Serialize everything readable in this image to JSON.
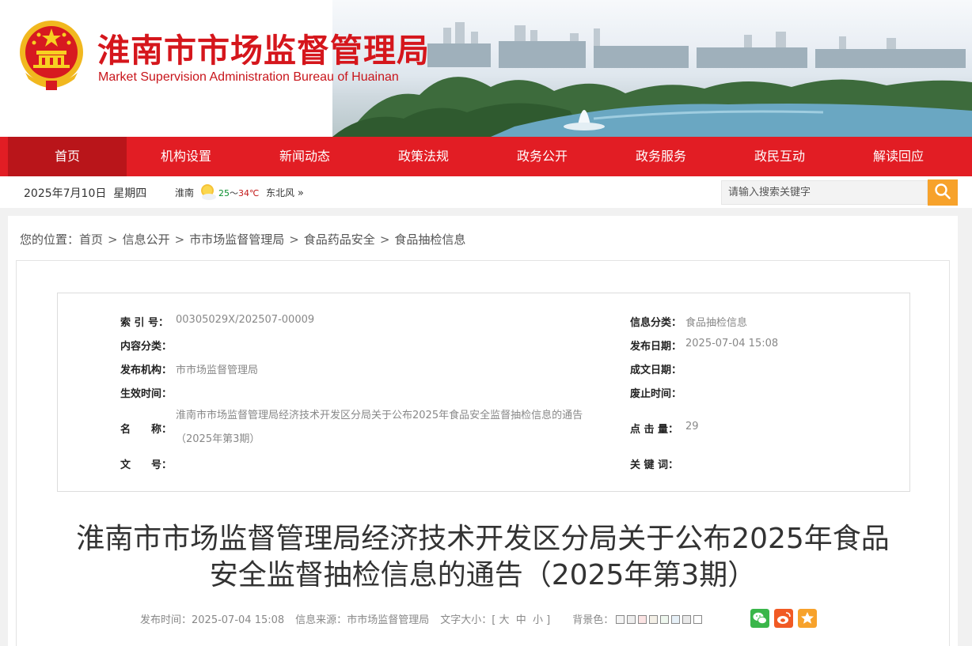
{
  "header": {
    "title": "淮南市市场监督管理局",
    "subtitle": "Market Supervision Administration Bureau of Huainan"
  },
  "nav": {
    "items": [
      {
        "label": "首页"
      },
      {
        "label": "机构设置"
      },
      {
        "label": "新闻动态"
      },
      {
        "label": "政策法规"
      },
      {
        "label": "政务公开"
      },
      {
        "label": "政务服务"
      },
      {
        "label": "政民互动"
      },
      {
        "label": "解读回应"
      }
    ],
    "active_index": 0
  },
  "utility": {
    "date": "2025年7月10日",
    "weekday": "星期四",
    "city": "淮南",
    "temp_low": "25",
    "temp_sep": "～",
    "temp_high": "34℃",
    "wind": "东北风",
    "wind_more": "»",
    "weather_icon": "sun-cloud-icon"
  },
  "search": {
    "placeholder": "请输入搜索关键字",
    "icon": "search-icon"
  },
  "breadcrumb": {
    "prefix": "您的位置：",
    "items": [
      "首页",
      "信息公开",
      "市市场监督管理局",
      "食品药品安全",
      "食品抽检信息"
    ],
    "separator": ">"
  },
  "meta": {
    "index_no_label": "索 引 号：",
    "index_no": "00305029X/202507-00009",
    "category_label": "信息分类：",
    "category": "食品抽检信息",
    "content_type_label": "内容分类：",
    "content_type": "",
    "publish_date_label": "发布日期：",
    "publish_date": "2025-07-04 15:08",
    "publisher_label": "发布机构：",
    "publisher": "市市场监督管理局",
    "written_date_label": "成文日期：",
    "written_date": "",
    "effective_label": "生效时间：",
    "effective": "",
    "expire_label": "废止时间：",
    "expire": "",
    "name_label": "名　　称：",
    "name": "淮南市市场监督管理局经济技术开发区分局关于公布2025年食品安全监督抽检信息的通告（2025年第3期）",
    "clicks_label": "点 击 量：",
    "clicks": "29",
    "doc_no_label": "文　　号：",
    "doc_no": "",
    "keywords_label": "关 键 词：",
    "keywords": ""
  },
  "article": {
    "title_line1": "淮南市市场监督管理局经济技术开发区分局关于公布2025年食品",
    "title_line2": "安全监督抽检信息的通告（2025年第3期）",
    "publish_time_label": "发布时间：",
    "publish_time": "2025-07-04 15:08",
    "source_label": "信息来源：",
    "source": "市市场监督管理局",
    "font_size_label": "文字大小：",
    "font_open": "[",
    "font_large": "大",
    "font_medium": "中",
    "font_small": "小",
    "font_close": "]",
    "bg_label": "背景色：",
    "bg_colors": [
      "#f4f4f4",
      "#eeeeee",
      "#fbe3e3",
      "#f3efe6",
      "#eef7ee",
      "#e6f0f7",
      "#e9e9e9",
      "#ffffff"
    ]
  },
  "share": {
    "icons": [
      "wechat-icon",
      "weibo-icon",
      "favorite-icon"
    ],
    "colors": [
      "#3ab64a",
      "#f15a24",
      "#f7a22b"
    ]
  }
}
